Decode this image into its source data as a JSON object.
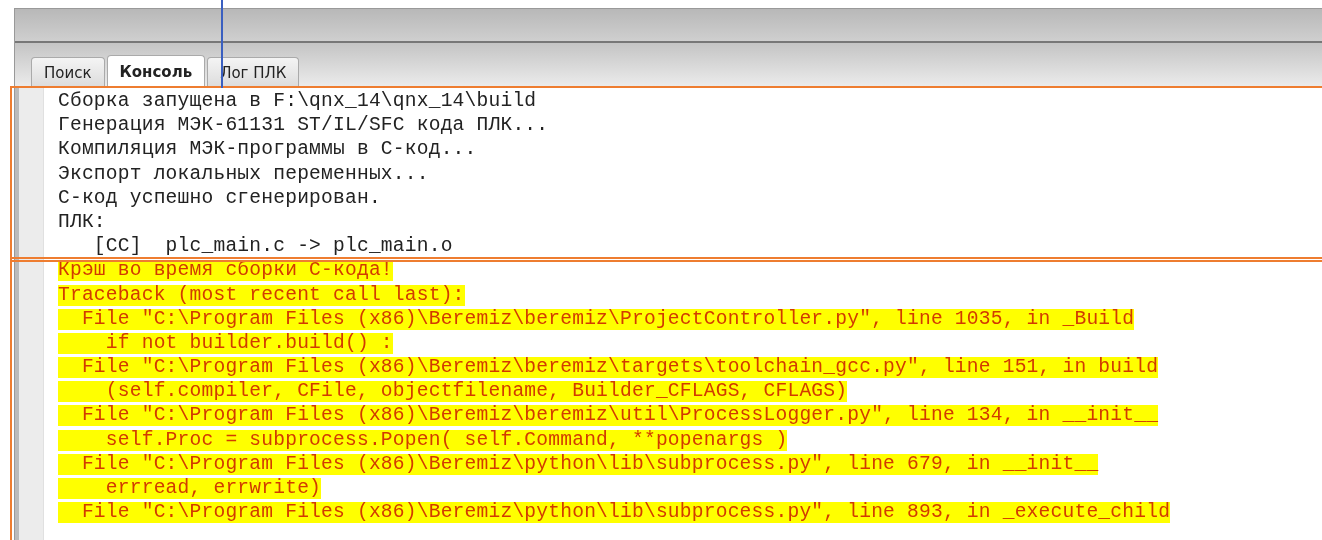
{
  "tabs": [
    {
      "label": "Поиск",
      "selected": false
    },
    {
      "label": "Консоль",
      "selected": true
    },
    {
      "label": "Лог ПЛК",
      "selected": false
    }
  ],
  "console": {
    "lines": [
      {
        "kind": "normal",
        "text": "Сборка запущена в F:\\qnx_14\\qnx_14\\build"
      },
      {
        "kind": "normal",
        "text": "Генерация МЭК-61131 ST/IL/SFC кода ПЛК..."
      },
      {
        "kind": "normal",
        "text": "Компиляция МЭК-программы в С-код..."
      },
      {
        "kind": "normal",
        "text": "Экспорт локальных переменных..."
      },
      {
        "kind": "normal",
        "text": "С-код успешно сгенерирован."
      },
      {
        "kind": "normal",
        "text": "ПЛК:"
      },
      {
        "kind": "normal",
        "text": "   [CC]  plc_main.c -> plc_main.o"
      },
      {
        "kind": "error",
        "text": "Крэш во время сборки С-кода!"
      },
      {
        "kind": "error",
        "text": "Traceback (most recent call last):"
      },
      {
        "kind": "error",
        "text": "  File \"C:\\Program Files (x86)\\Beremiz\\beremiz\\ProjectController.py\", line 1035, in _Build"
      },
      {
        "kind": "error",
        "text": "    if not builder.build() :"
      },
      {
        "kind": "error",
        "text": "  File \"C:\\Program Files (x86)\\Beremiz\\beremiz\\targets\\toolchain_gcc.py\", line 151, in build"
      },
      {
        "kind": "error",
        "text": "    (self.compiler, CFile, objectfilename, Builder_CFLAGS, CFLAGS)"
      },
      {
        "kind": "error",
        "text": "  File \"C:\\Program Files (x86)\\Beremiz\\beremiz\\util\\ProcessLogger.py\", line 134, in __init__"
      },
      {
        "kind": "error",
        "text": "    self.Proc = subprocess.Popen( self.Command, **popenargs )"
      },
      {
        "kind": "error",
        "text": "  File \"C:\\Program Files (x86)\\Beremiz\\python\\lib\\subprocess.py\", line 679, in __init__"
      },
      {
        "kind": "error",
        "text": "    errread, errwrite)"
      },
      {
        "kind": "error",
        "text": "  File \"C:\\Program Files (x86)\\Beremiz\\python\\lib\\subprocess.py\", line 893, in _execute_child"
      }
    ]
  }
}
